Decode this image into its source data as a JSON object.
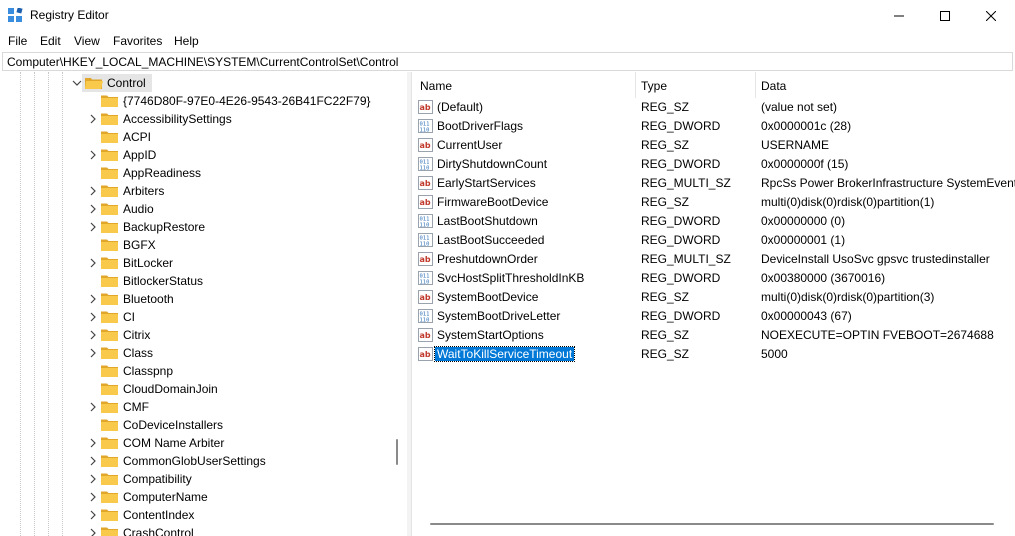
{
  "window": {
    "title": "Registry Editor",
    "icons": {
      "app": "registry-icon",
      "minimize": "minimize-icon",
      "maximize": "maximize-icon",
      "close": "close-icon"
    }
  },
  "menu": [
    "File",
    "Edit",
    "View",
    "Favorites",
    "Help"
  ],
  "address": "Computer\\HKEY_LOCAL_MACHINE\\SYSTEM\\CurrentControlSet\\Control",
  "tree": {
    "parent": {
      "label": "Control",
      "expanded": true,
      "selected": true
    },
    "children": [
      {
        "label": "{7746D80F-97E0-4E26-9543-26B41FC22F79}",
        "has_children": false
      },
      {
        "label": "AccessibilitySettings",
        "has_children": true
      },
      {
        "label": "ACPI",
        "has_children": false
      },
      {
        "label": "AppID",
        "has_children": true
      },
      {
        "label": "AppReadiness",
        "has_children": false
      },
      {
        "label": "Arbiters",
        "has_children": true
      },
      {
        "label": "Audio",
        "has_children": true
      },
      {
        "label": "BackupRestore",
        "has_children": true
      },
      {
        "label": "BGFX",
        "has_children": false
      },
      {
        "label": "BitLocker",
        "has_children": true
      },
      {
        "label": "BitlockerStatus",
        "has_children": false
      },
      {
        "label": "Bluetooth",
        "has_children": true
      },
      {
        "label": "CI",
        "has_children": true
      },
      {
        "label": "Citrix",
        "has_children": true
      },
      {
        "label": "Class",
        "has_children": true
      },
      {
        "label": "Classpnp",
        "has_children": false
      },
      {
        "label": "CloudDomainJoin",
        "has_children": false
      },
      {
        "label": "CMF",
        "has_children": true
      },
      {
        "label": "CoDeviceInstallers",
        "has_children": false
      },
      {
        "label": "COM Name Arbiter",
        "has_children": true
      },
      {
        "label": "CommonGlobUserSettings",
        "has_children": true
      },
      {
        "label": "Compatibility",
        "has_children": true
      },
      {
        "label": "ComputerName",
        "has_children": true
      },
      {
        "label": "ContentIndex",
        "has_children": true
      },
      {
        "label": "CrashControl",
        "has_children": true
      }
    ]
  },
  "list": {
    "columns": [
      "Name",
      "Type",
      "Data"
    ],
    "rows": [
      {
        "name": "(Default)",
        "type": "REG_SZ",
        "data": "(value not set)",
        "icon": "string-value-icon"
      },
      {
        "name": "BootDriverFlags",
        "type": "REG_DWORD",
        "data": "0x0000001c (28)",
        "icon": "binary-value-icon"
      },
      {
        "name": "CurrentUser",
        "type": "REG_SZ",
        "data": "USERNAME",
        "icon": "string-value-icon"
      },
      {
        "name": "DirtyShutdownCount",
        "type": "REG_DWORD",
        "data": "0x0000000f (15)",
        "icon": "binary-value-icon"
      },
      {
        "name": "EarlyStartServices",
        "type": "REG_MULTI_SZ",
        "data": "RpcSs Power BrokerInfrastructure SystemEvents",
        "icon": "string-value-icon"
      },
      {
        "name": "FirmwareBootDevice",
        "type": "REG_SZ",
        "data": "multi(0)disk(0)rdisk(0)partition(1)",
        "icon": "string-value-icon"
      },
      {
        "name": "LastBootShutdown",
        "type": "REG_DWORD",
        "data": "0x00000000 (0)",
        "icon": "binary-value-icon"
      },
      {
        "name": "LastBootSucceeded",
        "type": "REG_DWORD",
        "data": "0x00000001 (1)",
        "icon": "binary-value-icon"
      },
      {
        "name": "PreshutdownOrder",
        "type": "REG_MULTI_SZ",
        "data": "DeviceInstall UsoSvc gpsvc trustedinstaller",
        "icon": "string-value-icon"
      },
      {
        "name": "SvcHostSplitThresholdInKB",
        "type": "REG_DWORD",
        "data": "0x00380000 (3670016)",
        "icon": "binary-value-icon"
      },
      {
        "name": "SystemBootDevice",
        "type": "REG_SZ",
        "data": "multi(0)disk(0)rdisk(0)partition(3)",
        "icon": "string-value-icon"
      },
      {
        "name": "SystemBootDriveLetter",
        "type": "REG_DWORD",
        "data": "0x00000043 (67)",
        "icon": "binary-value-icon"
      },
      {
        "name": "SystemStartOptions",
        "type": "REG_SZ",
        "data": " NOEXECUTE=OPTIN  FVEBOOT=2674688",
        "icon": "string-value-icon"
      },
      {
        "name": "WaitToKillServiceTimeout",
        "type": "REG_SZ",
        "data": "5000",
        "icon": "string-value-icon",
        "selected": true
      }
    ]
  },
  "colors": {
    "accent": "#0078d7",
    "folder": "#f8c94a",
    "folder_dark": "#e0a72a",
    "string_icon": "#c0392b",
    "dword_icon": "#2a6fb5"
  }
}
